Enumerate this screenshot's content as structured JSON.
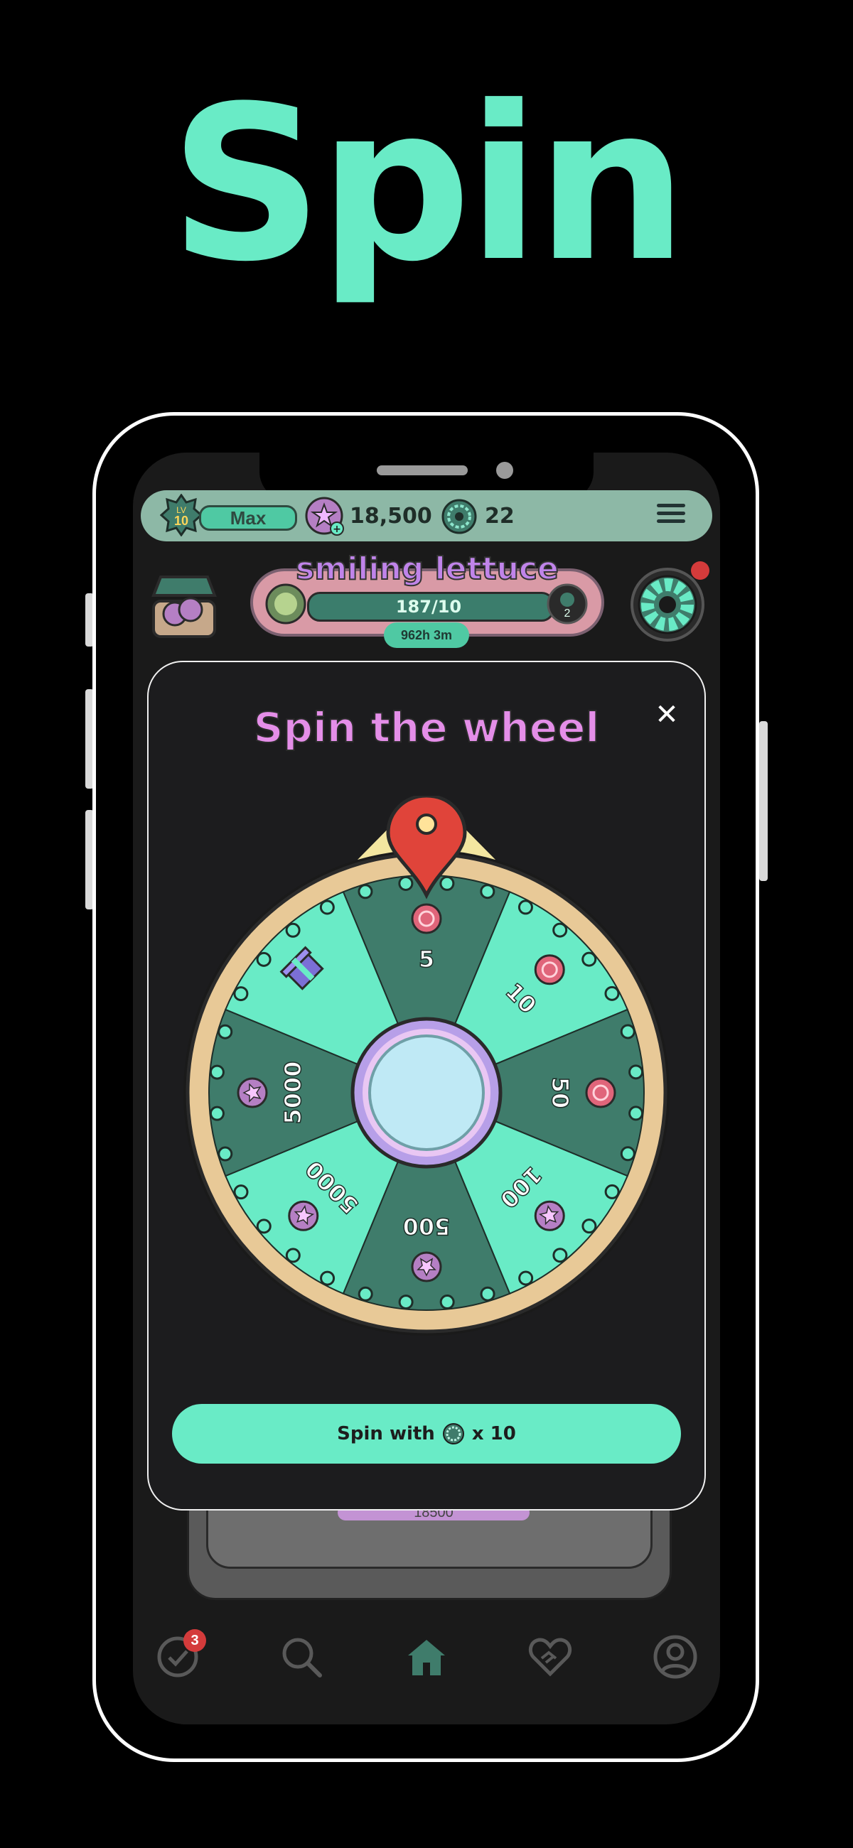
{
  "hero": {
    "title": "Spin"
  },
  "topbar": {
    "level_label": "LV",
    "level_value": "10",
    "username": "Max",
    "coins": "18,500",
    "spins": "22"
  },
  "progress": {
    "title": "smiling lettuce",
    "value": "187/10",
    "badge": "2",
    "timer": "962h 3m"
  },
  "modal": {
    "title": "Spin the wheel",
    "close_label": "✕",
    "spin_button_prefix": "Spin with",
    "spin_button_suffix": "x 10",
    "under_value": "18500"
  },
  "wheel": {
    "segments": [
      {
        "label": "5",
        "reward": "token"
      },
      {
        "label": "10",
        "reward": "token"
      },
      {
        "label": "50",
        "reward": "token"
      },
      {
        "label": "100",
        "reward": "star-coin"
      },
      {
        "label": "500",
        "reward": "star-coin"
      },
      {
        "label": "5000",
        "reward": "star-coin"
      },
      {
        "label": "5000",
        "reward": "star-coin"
      },
      {
        "label": "",
        "reward": "gift"
      }
    ],
    "colors": {
      "dark": "#3f7c6b",
      "light": "#69ebc6",
      "rim": "#e8c997",
      "pointer": "#e0443a"
    }
  },
  "nav": {
    "tasks_badge": "3",
    "items": [
      "tasks-icon",
      "search-icon",
      "home-icon",
      "heart-handshake-icon",
      "profile-icon"
    ]
  }
}
